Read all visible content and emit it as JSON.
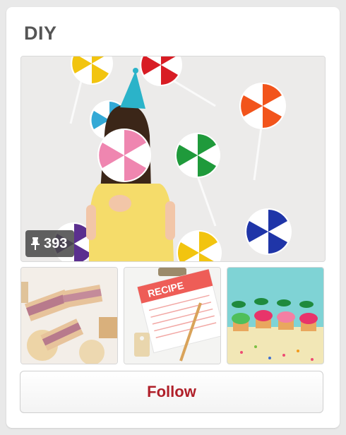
{
  "board": {
    "title": "DIY",
    "pin_count": "393",
    "pin_icon": "pin-icon",
    "follow_label": "Follow"
  },
  "thumbnails": [
    {
      "name": "dessert-bars-thumbnail"
    },
    {
      "name": "recipe-card-thumbnail",
      "text": "RECIPE"
    },
    {
      "name": "cupcakes-thumbnail"
    }
  ],
  "colors": {
    "follow_text": "#b0202a",
    "title_text": "#555555",
    "badge_bg": "#464646"
  }
}
